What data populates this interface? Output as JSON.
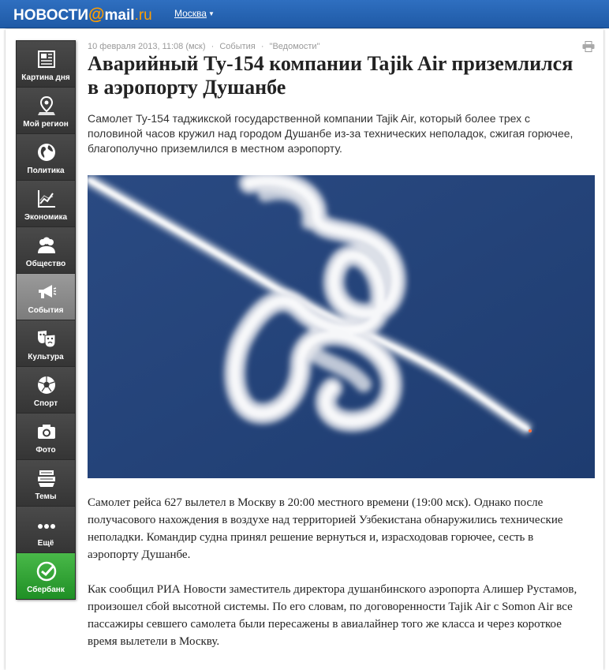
{
  "header": {
    "logo_news": "НОВОСТИ",
    "logo_at": "@",
    "logo_mail": "mail",
    "logo_ru": ".ru",
    "region": "Москва"
  },
  "sidebar": {
    "items": [
      {
        "label": "Картина дня",
        "icon": "newspaper-icon"
      },
      {
        "label": "Мой регион",
        "icon": "map-pin-icon"
      },
      {
        "label": "Политика",
        "icon": "globe-icon"
      },
      {
        "label": "Экономика",
        "icon": "chart-icon"
      },
      {
        "label": "Общество",
        "icon": "people-icon"
      },
      {
        "label": "События",
        "icon": "megaphone-icon",
        "active": true
      },
      {
        "label": "Культура",
        "icon": "theater-masks-icon"
      },
      {
        "label": "Спорт",
        "icon": "soccer-ball-icon"
      },
      {
        "label": "Фото",
        "icon": "camera-icon"
      },
      {
        "label": "Темы",
        "icon": "stack-icon"
      },
      {
        "label": "Ещё",
        "icon": "more-dots-icon"
      },
      {
        "label": "Сбербанк",
        "icon": "sberbank-logo-icon"
      }
    ]
  },
  "article": {
    "date": "10 февраля 2013, 11:08 (мск)",
    "sep1": "·",
    "category": "События",
    "sep2": "·",
    "source": "\"Ведомости\"",
    "title": "Аварийный Ту-154 компании Tajik Air приземлился в аэропорту Душанбе",
    "lead": "Самолет Ту-154 таджикской государственной компании Tajik Air, который более трех с половиной часов кружил над городом Душанбе из-за технических неполадок, сжигая горючее, благополучно приземлился в местном аэропорту.",
    "paragraph1": "Самолет рейса 627 вылетел в Москву в 20:00 местного времени (19:00 мск). Однако после получасового нахождения в воздухе над территорией Узбекистана обнаружились технические неполадки. Командир судна принял решение вернуться и, израсходовав горючее, сесть в аэропорту Душанбе.",
    "paragraph2": "Как сообщил РИА Новости заместитель директора душанбинского аэропорта Алишер Рустамов, произошел сбой высотной системы. По его словам, по договоренности Tajik Air с Somon Air все пассажиры севшего самолета были пересажены в авиалайнер того же класса и через короткое время вылетели в Москву."
  },
  "colors": {
    "header_blue": "#1f5aa6",
    "logo_orange": "#ff9e00",
    "sidebar_dark": "#3b3b3b",
    "sidebar_active": "#8a8a8a",
    "sberbank_green": "#2aa12f",
    "sky_blue": "#24447b"
  }
}
